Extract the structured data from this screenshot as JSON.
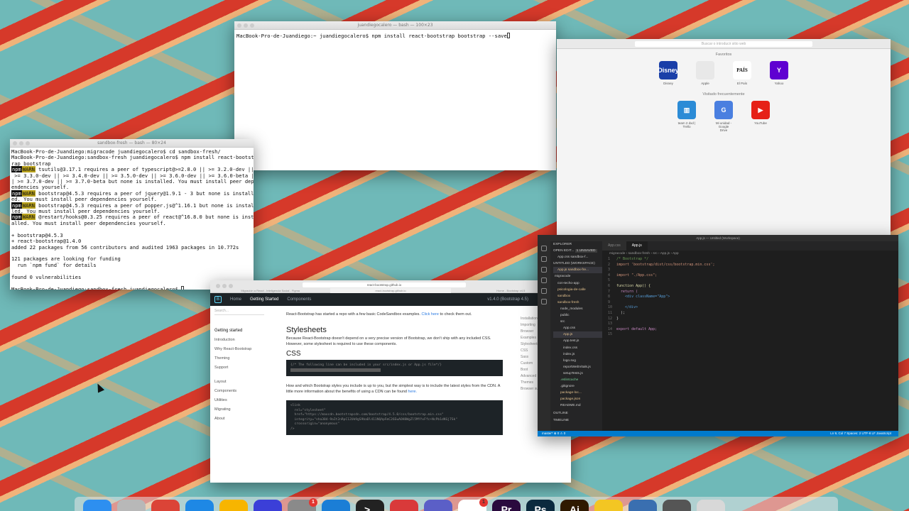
{
  "terminal_top": {
    "title": "juandiegocalero — bash — 100×23",
    "prompt": "MacBook-Pro-de-Juandiego:~ juandiegocalero$ npm install react-bootstrap bootstrap --save"
  },
  "terminal_left": {
    "title": "sandbox-fresh — bash — 80×24",
    "lines": [
      "MacBook-Pro-de-Juandiego:migracode juandiegocalero$ cd sandbox-fresh/",
      "MacBook-Pro-de-Juandiego:sandbox-fresh juandiegocalero$ npm install react-bootst",
      "rap bootstrap",
      "tsutils@3.17.1 requires a peer of typescript@>=2.8.0 || >= 3.2.0-dev ||",
      " >= 3.3.0-dev || >= 3.4.0-dev || >= 3.5.0-dev || >= 3.6.0-dev || >= 3.6.0-beta |",
      "| >= 3.7.0-dev || >= 3.7.0-beta but none is installed. You must install peer dep",
      "endencies yourself.",
      "bootstrap@4.5.3 requires a peer of jquery@1.9.1 - 3 but none is install",
      "ed. You must install peer dependencies yourself.",
      "bootstrap@4.5.3 requires a peer of popper.js@^1.16.1 but none is instal",
      "led. You must install peer dependencies yourself.",
      "@restart/hooks@0.3.25 requires a peer of react@^16.8.0 but none is inst",
      "alled. You must install peer dependencies yourself.",
      "",
      "+ bootstrap@4.5.3",
      "+ react-bootstrap@1.4.0",
      "added 22 packages from 56 contributors and audited 1963 packages in 10.772s",
      "",
      "121 packages are looking for funding",
      "  run `npm fund` for details",
      "",
      "found 0 vulnerabilities",
      "",
      "MacBook-Pro-de-Juandiego:sandbox-fresh juandiegocalero$"
    ],
    "npm": "npm",
    "warn": "WARN"
  },
  "safari": {
    "address_placeholder": "Buscar o introducir sitio web",
    "favorites_heading": "Favoritos",
    "frequent_heading": "Visitado frecuentemente",
    "favorites": [
      {
        "label": "Disney",
        "glyph": "Disney",
        "color": "#1a3fa8"
      },
      {
        "label": "Apple",
        "glyph": "",
        "color": "#e8e8e8"
      },
      {
        "label": "El País",
        "glyph": "PAÍS",
        "color": "#ffffff"
      },
      {
        "label": "Yahoo",
        "glyph": "Y",
        "color": "#5f01d1"
      }
    ],
    "frequent": [
      {
        "label": "team 2 dxd | Trello",
        "glyph": "▥",
        "color": "#2b8bd6"
      },
      {
        "label": "Mi unidad - Google Drive",
        "glyph": "G",
        "color": "#4a7fe0"
      },
      {
        "label": "YouTube",
        "glyph": "▶",
        "color": "#e62117"
      }
    ]
  },
  "docs": {
    "tab1": "Migración a React - Inteligencia Social - Figma",
    "url": "react-bootstrap.github.io",
    "tab3": "Home - Bootstrap v4.5",
    "nav": [
      "Home",
      "Getting Started",
      "Components"
    ],
    "version": "v1.4.0 (Bootstrap 4.5)",
    "search_placeholder": "Search...",
    "side": [
      "Getting started",
      "Introduction",
      "Why React-Bootstrap",
      "Theming",
      "Support",
      "Layout",
      "Components",
      "Utilities",
      "Migrating",
      "About"
    ],
    "intro": "React-Bootstrap has started a repo with a few basic CodeSandbox examples.",
    "intro_link": "Click here",
    "intro_tail": "to check them out.",
    "h_stylesheets": "Stylesheets",
    "p_stylesheets": "Because React-Bootstrap doesn't depend on a very precise version of Bootstrap, we don't ship with any included CSS. However, some stylesheet is required to use these components.",
    "h_css": "CSS",
    "code1": "{/* The following line can be included in your src/index.js or App.js file*/}",
    "code1b": "import 'bootstrap/dist/css/bootstrap.min.css';",
    "p_cdn": "How and which Bootstrap styles you include is up to you, but the simplest way is to include the latest styles from the CDN. A little more information about the benefits of using a CDN can be found",
    "p_cdn_link": "here.",
    "code2": "<link\n  rel=\"stylesheet\"\n  href=\"https://maxcdn.bootstrapcdn.com/bootstrap/4.5.0/css/bootstrap.min.css\"\n  integrity=\"sha384-9aIt2nRpC12Uk9gS9baDl411NQApFmC26EwAOH8WgZl5MYYxFfc+NcPb1dKGj7Sk\"\n  crossorigin=\"anonymous\"\n/>",
    "toc": [
      "Installation",
      "Importing",
      "Browser",
      "Examples",
      "Stylesheets",
      "CSS",
      "Sass",
      "Custom",
      "Boot",
      "Advanced",
      "Themes",
      "Browser su"
    ]
  },
  "vscode": {
    "title": "App.js — Untitled (Workspace)",
    "explorer_head": "EXPLORER",
    "open_editors": "OPEN EDIT...",
    "unsaved": "1 UNSAVED",
    "workspace": "UNTITLED (WORKSPACE)",
    "tree": [
      "App.css  sandbox-f...",
      "App.js  sandbox-fre...",
      "migracode",
      "con-techo-app",
      "psicologia-de-calle",
      "sandbox",
      "sandbox-fresh",
      "node_modules",
      "public",
      "src",
      "App.css",
      "App.js",
      "App.test.js",
      "index.css",
      "index.js",
      "logo.svg",
      "reportWebVitals.js",
      "setupTests.js",
      ".eslintcache",
      ".gitignore",
      "package-loc...",
      "package.json",
      "README.md"
    ],
    "outline": "OUTLINE",
    "timeline": "TIMELINE",
    "tabs": [
      "App.css",
      "App.js"
    ],
    "crumb": "migracode › sandbox-fresh › src › App.js › App",
    "code": [
      "/* Bootstrap */",
      "import 'bootstrap/dist/css/bootstrap.min.css';",
      "",
      "import \"./App.css\";",
      "",
      "function App() {",
      "  return (",
      "    <div className=\"App\">",
      "",
      "    </div>",
      "  );",
      "}",
      "",
      "export default App;",
      ""
    ],
    "status_left": "master*  ⊗ 0 ⚠ 0",
    "status_right": "Ln 9, Col 7   Spaces: 2   UTF-8   LF   JavaScript"
  },
  "dock": {
    "apps": [
      {
        "name": "finder-icon",
        "color": "#2d8ff0",
        "glyph": ""
      },
      {
        "name": "launchpad-icon",
        "color": "#b8b8b8",
        "glyph": ""
      },
      {
        "name": "chrome-icon",
        "color": "#db4437",
        "glyph": ""
      },
      {
        "name": "safari-icon",
        "color": "#1e88e5",
        "glyph": ""
      },
      {
        "name": "sketch-icon",
        "color": "#f7b500",
        "glyph": ""
      },
      {
        "name": "lasso-icon",
        "color": "#3b3fd8",
        "glyph": ""
      },
      {
        "name": "system-preferences-icon",
        "color": "#8a8a8a",
        "glyph": "",
        "badge": "1"
      },
      {
        "name": "vscode-icon",
        "color": "#1b7ed6",
        "glyph": ""
      },
      {
        "name": "terminal-icon",
        "color": "#222222",
        "glyph": ">_"
      },
      {
        "name": "todo-icon",
        "color": "#d93a3a",
        "glyph": ""
      },
      {
        "name": "teams-icon",
        "color": "#5b5fc7",
        "glyph": ""
      },
      {
        "name": "slack-icon",
        "color": "#ffffff",
        "glyph": "",
        "badge": "1"
      },
      {
        "name": "premiere-icon",
        "color": "#2a0a3e",
        "glyph": "Pr"
      },
      {
        "name": "photoshop-icon",
        "color": "#0b2a3e",
        "glyph": "Ps"
      },
      {
        "name": "illustrator-icon",
        "color": "#2f1a00",
        "glyph": "Ai"
      },
      {
        "name": "cyberduck-icon",
        "color": "#f3c623",
        "glyph": ""
      },
      {
        "name": "misc-app-icon",
        "color": "#3a6fb0",
        "glyph": ""
      },
      {
        "name": "window-icon",
        "color": "#555555",
        "glyph": ""
      },
      {
        "name": "trash-icon",
        "color": "#d8d8d8",
        "glyph": ""
      }
    ]
  }
}
